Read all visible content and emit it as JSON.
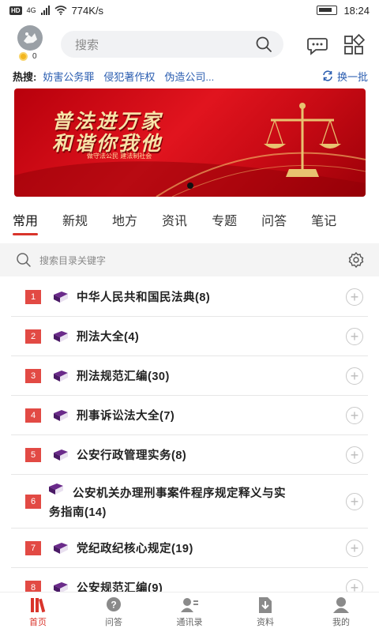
{
  "status_bar": {
    "hd": "HD",
    "network": "4G",
    "speed": "774K/s",
    "time": "18:24",
    "battery_icon": "battery-icon"
  },
  "header": {
    "coins": "0",
    "search_placeholder": "搜索",
    "icons": [
      "search-icon",
      "message-icon",
      "apps-grid-icon"
    ]
  },
  "hot_search": {
    "label": "热搜:",
    "keywords": [
      "妨害公务罪",
      "侵犯著作权",
      "伪造公司..."
    ],
    "refresh_label": "换一批"
  },
  "banner": {
    "line1": "普法进万家",
    "line2": "和谐你我他",
    "subtitle": "做守法公民 建法制社会"
  },
  "tabs": [
    {
      "label": "常用",
      "active": true
    },
    {
      "label": "新规"
    },
    {
      "label": "地方"
    },
    {
      "label": "资讯"
    },
    {
      "label": "专题"
    },
    {
      "label": "问答"
    },
    {
      "label": "笔记"
    }
  ],
  "catalog_search": {
    "placeholder": "搜索目录关键字"
  },
  "catalog": [
    {
      "num": "1",
      "title": "中华人民共和国民法典(8)"
    },
    {
      "num": "2",
      "title": "刑法大全(4)"
    },
    {
      "num": "3",
      "title": "刑法规范汇编(30)"
    },
    {
      "num": "4",
      "title": "刑事诉讼法大全(7)"
    },
    {
      "num": "5",
      "title": "公安行政管理实务(8)"
    },
    {
      "num": "6",
      "title_line1": "公安机关办理刑事案件程序规定释义与实",
      "title_line2": "务指南(14)"
    },
    {
      "num": "7",
      "title": "党纪政纪核心规定(19)"
    },
    {
      "num": "8",
      "title": "公安规范汇编(9)"
    }
  ],
  "bottom_nav": [
    {
      "label": "首页",
      "icon": "books-icon",
      "active": true
    },
    {
      "label": "问答",
      "icon": "question-bubble-icon"
    },
    {
      "label": "通讯录",
      "icon": "contacts-icon"
    },
    {
      "label": "资料",
      "icon": "download-doc-icon"
    },
    {
      "label": "我的",
      "icon": "user-icon"
    }
  ],
  "colors": {
    "accent": "#d9342b",
    "link": "#2a5db0",
    "number_badge": "#e24a44",
    "book": "#6a2a8a"
  }
}
